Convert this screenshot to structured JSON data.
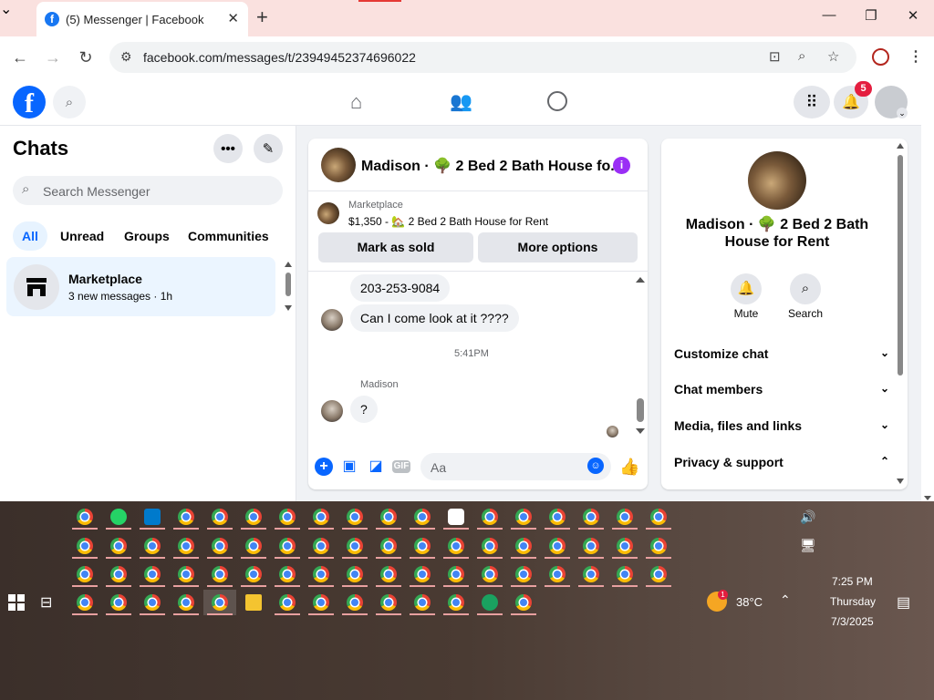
{
  "browser": {
    "tab_title": "(5) Messenger | Facebook",
    "url": "facebook.com/messages/t/23949452374696022"
  },
  "fb": {
    "notif_count": "5"
  },
  "sidebar": {
    "title": "Chats",
    "search_placeholder": "Search Messenger",
    "filters": [
      "All",
      "Unread",
      "Groups",
      "Communities"
    ],
    "chat": {
      "name": "Marketplace",
      "sub": "3 new messages · 1h"
    }
  },
  "conversation": {
    "title": "Madison · 🌳 2 Bed 2 Bath House fo...",
    "marketplace_label": "Marketplace",
    "listing": "$1,350 - 🏡 2 Bed 2 Bath House for Rent",
    "mark_sold": "Mark as sold",
    "more_options": "More options",
    "messages": {
      "phone": "203-253-9084",
      "question": "Can I come look at it ????",
      "time": "5:41PM",
      "sender": "Madison",
      "q": "?"
    },
    "composer_placeholder": "Aa",
    "gif": "GIF"
  },
  "details": {
    "name": "Madison · 🌳 2 Bed 2 Bath House for Rent",
    "mute": "Mute",
    "search": "Search",
    "sections": [
      "Customize chat",
      "Chat members",
      "Media, files and links",
      "Privacy & support"
    ]
  },
  "taskbar": {
    "weather": "38°C",
    "weather_badge": "1",
    "time": "7:25 PM",
    "day": "Thursday",
    "date": "7/3/2025"
  }
}
